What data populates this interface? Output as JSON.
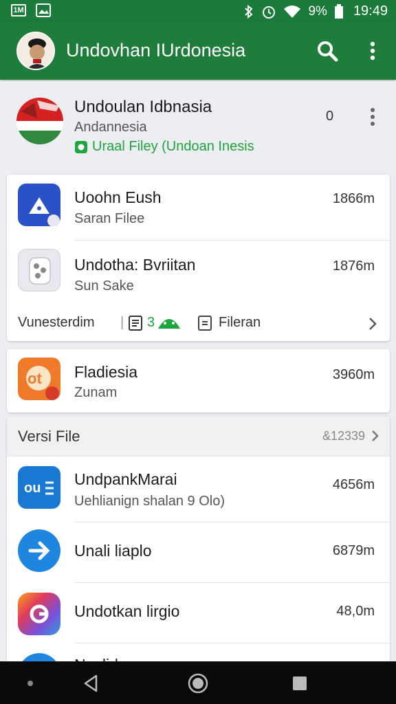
{
  "status_bar": {
    "left_icon_1": "1M",
    "time": "19:49",
    "battery_text": "9%"
  },
  "app_bar": {
    "title": "Undovhan IUrdonesia"
  },
  "header": {
    "title": "Undoulan Idbnasia",
    "subtitle": "Andannesia",
    "link": "Uraal Filey (Undoan Inesis"
  },
  "header_count": "0",
  "card1": {
    "items": [
      {
        "name": "Uoohn Eush",
        "sub": "Saran Filee",
        "size": "1866m"
      },
      {
        "name": "Undotha: Bvriitan",
        "sub": "Sun Sake",
        "size": "1876m"
      }
    ],
    "footer": {
      "left": "Vunesterdim",
      "mid": "3",
      "right": "Fileran"
    }
  },
  "card2": {
    "items": [
      {
        "name": "Fladiesia",
        "sub": "Zunam",
        "size": "3960m"
      }
    ]
  },
  "section": {
    "title": "Versi File",
    "count": "&12339"
  },
  "list": [
    {
      "name": "UndpankMarai",
      "sub": "Uehlianign shalan 9 Olo)",
      "size": "4656m"
    },
    {
      "name": "Unali liaplo",
      "sub": "",
      "size": "6879m"
    },
    {
      "name": "Undotkan lirgio",
      "sub": "",
      "size": "48,0m"
    },
    {
      "name": "Nuslid",
      "sub": "",
      "size": ""
    }
  ],
  "colors": {
    "primary": "#1f7d3c",
    "accent": "#1da53f",
    "nav": "#0a0a0a"
  },
  "icons": [
    "signal-icon",
    "image-icon",
    "bluetooth-icon",
    "alarm-icon",
    "wifi-icon",
    "battery-icon",
    "search-icon",
    "more-vert-icon",
    "chevron-right-icon",
    "back-icon",
    "home-icon",
    "recents-icon"
  ]
}
